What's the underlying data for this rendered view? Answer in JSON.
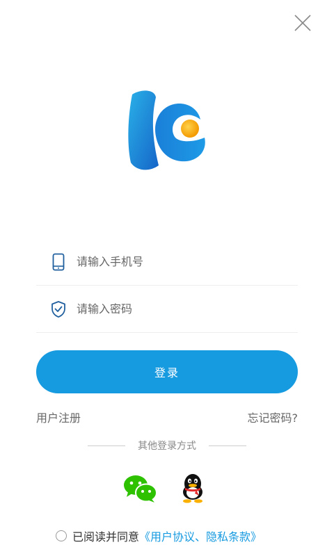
{
  "header": {
    "close_icon": "close-icon"
  },
  "logo": {
    "icon": "app-logo",
    "colors": {
      "primary": "#1f7fd6",
      "secondary": "#2ab0e8",
      "dot": "#f7b000"
    }
  },
  "form": {
    "phone": {
      "icon": "phone-icon",
      "placeholder": "请输入手机号",
      "value": ""
    },
    "password": {
      "icon": "shield-check-icon",
      "placeholder": "请输入密码",
      "value": ""
    },
    "login_label": "登录"
  },
  "links": {
    "register": "用户注册",
    "forgot": "忘记密码?"
  },
  "other_login": {
    "label": "其他登录方式",
    "providers": [
      {
        "name": "wechat",
        "icon": "wechat-icon"
      },
      {
        "name": "qq",
        "icon": "qq-icon"
      }
    ]
  },
  "agreement": {
    "checked": false,
    "text": "已阅读并同意",
    "link": "《用户协议、隐私条款》"
  },
  "colors": {
    "accent": "#169ae0",
    "text_secondary": "#666666"
  }
}
